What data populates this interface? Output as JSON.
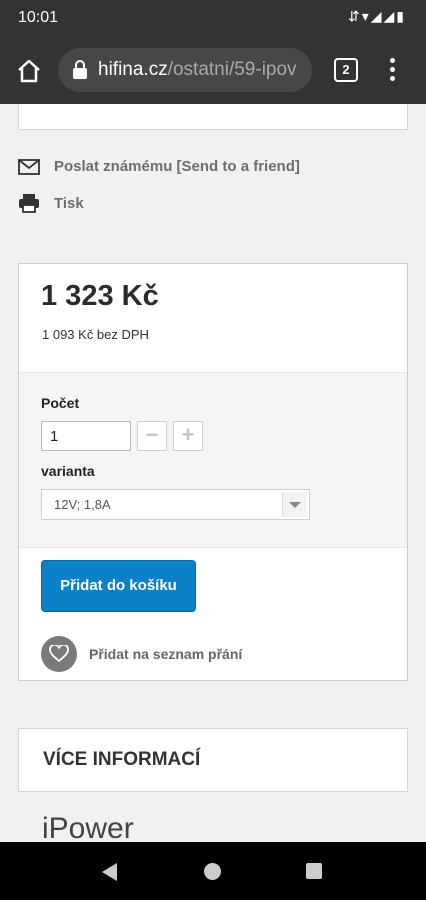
{
  "status_bar": {
    "time": "10:01"
  },
  "browser": {
    "url_host": "hifina.cz",
    "url_path": "/ostatni/59-ipov",
    "tab_count": "2"
  },
  "links": {
    "send_friend": "Poslat známému [Send to a friend]",
    "print": "Tisk"
  },
  "product": {
    "price": "1 323 Kč",
    "price_without_vat": "1 093 Kč bez DPH",
    "quantity_label": "Počet",
    "quantity_value": "1",
    "minus": "−",
    "plus": "+",
    "variant_label": "varianta",
    "variant_selected": "12V; 1,8A",
    "add_to_cart": "Přidat do košíku",
    "wishlist": "Přidat na seznam přání"
  },
  "more_info": {
    "title": "VÍCE INFORMACÍ",
    "brand": "iPower"
  },
  "colors": {
    "accent": "#0b82c8",
    "toolbar": "#333333"
  }
}
